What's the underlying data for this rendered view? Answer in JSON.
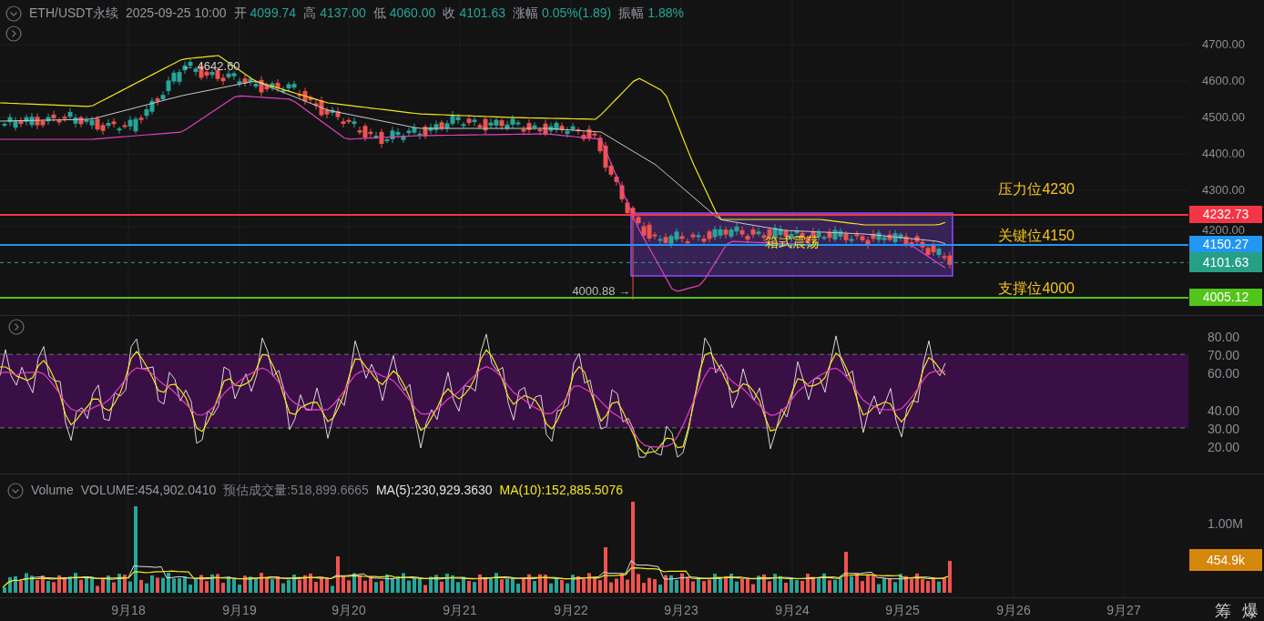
{
  "header": {
    "symbol": "ETH/USDT永续",
    "datetime": "2025-09-25 10:00",
    "stats": [
      {
        "label": "开",
        "value": "4099.74"
      },
      {
        "label": "高",
        "value": "4137.00"
      },
      {
        "label": "低",
        "value": "4060.00"
      },
      {
        "label": "收",
        "value": "4101.63"
      },
      {
        "label": "涨幅",
        "value": "0.05%(1.89)"
      },
      {
        "label": "振幅",
        "value": "1.88%"
      }
    ]
  },
  "price_pane": {
    "axis_labels": [
      "4700.00",
      "4600.00",
      "4500.00",
      "4400.00",
      "4300.00",
      "4200.00"
    ],
    "level_lines": [
      {
        "kind": "resistance",
        "label": "压力位4230",
        "tag": "4232.73",
        "color": "#f23645"
      },
      {
        "kind": "key",
        "label": "关键位4150",
        "tag": "4150.27",
        "color": "#2196f3"
      },
      {
        "kind": "support",
        "label": "支撑位4000",
        "tag": "4005.12",
        "color": "#52c41a"
      }
    ],
    "last_price": "4101.63",
    "box_label": "箱式震荡",
    "high_marker": "← 4642.60",
    "low_marker": "4000.88 →"
  },
  "rsi_pane": {
    "axis_labels": [
      "80.00",
      "70.00",
      "60.00",
      "40.00",
      "30.00",
      "20.00"
    ]
  },
  "volume_pane": {
    "legend": [
      {
        "text": "Volume",
        "color": "#9598a1"
      },
      {
        "text": "VOLUME:454,902.0410",
        "color": "#9598a1"
      },
      {
        "text": "预估成交量:518,899.6665",
        "color": "#7a7d85"
      },
      {
        "text": "MA(5):230,929.3630",
        "color": "#e0e0e0"
      },
      {
        "text": "MA(10):152,885.5076",
        "color": "#f5e61b"
      }
    ],
    "axis_label": "1.00M",
    "volume_tag": "454.9k"
  },
  "x_axis": [
    "9月18",
    "9月19",
    "9月20",
    "9月21",
    "9月22",
    "9月23",
    "9月24",
    "9月25",
    "9月26",
    "9月27"
  ],
  "footer_buttons": [
    "筹",
    "爆"
  ]
}
